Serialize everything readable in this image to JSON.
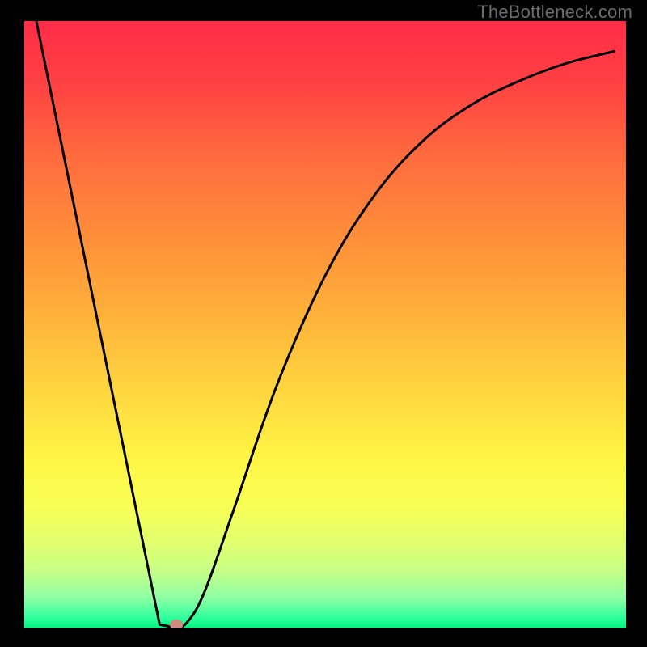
{
  "watermark": "TheBottleneck.com",
  "chart_data": {
    "type": "line",
    "title": "",
    "xlabel": "",
    "ylabel": "",
    "xlim": [
      0,
      100
    ],
    "ylim": [
      0,
      100
    ],
    "grid": false,
    "series": [
      {
        "name": "curve",
        "color": "#000000",
        "x": [
          2,
          22.5,
          25,
          27,
          30,
          35,
          42,
          50,
          58,
          66,
          74,
          82,
          90,
          98
        ],
        "y": [
          100,
          0.5,
          0,
          0.8,
          6,
          20,
          40,
          58,
          71,
          80,
          86,
          90,
          93,
          95
        ]
      }
    ],
    "marker": {
      "x": 25.3,
      "y": 0.5,
      "color": "#cf8b7b",
      "rx": 1.1,
      "ry": 0.85
    },
    "background": {
      "stops": [
        {
          "offset": 0.0,
          "color": "#ff2c47"
        },
        {
          "offset": 0.1,
          "color": "#ff4043"
        },
        {
          "offset": 0.22,
          "color": "#ff6a3e"
        },
        {
          "offset": 0.35,
          "color": "#ff8d3a"
        },
        {
          "offset": 0.48,
          "color": "#ffb03a"
        },
        {
          "offset": 0.6,
          "color": "#ffd33e"
        },
        {
          "offset": 0.72,
          "color": "#fff545"
        },
        {
          "offset": 0.8,
          "color": "#f8ff55"
        },
        {
          "offset": 0.86,
          "color": "#e2ff6e"
        },
        {
          "offset": 0.905,
          "color": "#c7ff86"
        },
        {
          "offset": 0.952,
          "color": "#8dffa4"
        },
        {
          "offset": 0.982,
          "color": "#35ff9e"
        },
        {
          "offset": 1.0,
          "color": "#00f57e"
        }
      ]
    },
    "layout": {
      "outer_w": 800,
      "outer_h": 800,
      "inner_left": 30,
      "inner_top": 26,
      "inner_w": 744,
      "inner_h": 750
    }
  }
}
